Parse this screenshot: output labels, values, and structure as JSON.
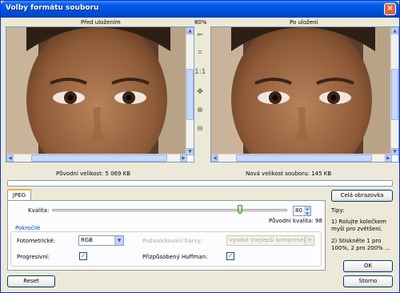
{
  "window": {
    "title": "Volby formátu souboru",
    "close_glyph": "×"
  },
  "zoom": "80%",
  "before": {
    "label": "Před uložením",
    "size_text": "Původní velikost:  5 069 KB"
  },
  "after": {
    "label": "Po uložení",
    "size_text": "Nová velikost souboru:  145 KB"
  },
  "toolbar": [
    {
      "icon": "arrow-left-icon",
      "glyph": "⇐"
    },
    {
      "icon": "fit-to-window-icon",
      "glyph": "⌗"
    },
    {
      "icon": "actual-size-icon",
      "glyph": "1:1"
    },
    {
      "icon": "pan-icon",
      "glyph": "✥"
    },
    {
      "icon": "zoom-in-icon",
      "glyph": "⊕"
    },
    {
      "icon": "zoom-out-icon",
      "glyph": "⊖"
    }
  ],
  "tabs": {
    "jpeg": "JPEG"
  },
  "quality": {
    "label": "Kvalita:",
    "value": "80",
    "fraction": 0.8,
    "original_text": "Původní kvalita: 98"
  },
  "advanced": {
    "title": "Pokročilé",
    "photometric_label": "Fotometrické:",
    "photometric_value": "RGB",
    "subsampling_label": "Podvzorkování barvy:",
    "subsampling_value": "Vysoké (nejlepší komprese)",
    "progressive_label": "Progresivní:",
    "progressive_checked": true,
    "huffman_label": "Přizpůsobený Huffman:",
    "huffman_checked": true
  },
  "buttons": {
    "fullscreen": "Celá obrazovka",
    "ok": "OK",
    "cancel": "Storno",
    "reset": "Reset"
  },
  "tips": {
    "title": "Tipy:",
    "tip1": "1) Rolujte kolečkem myši pro zvětšení.",
    "tip2": "2) Stiskněte 1 pro 100%, 2 pro 200% ..."
  },
  "colors": {
    "title_blue": "#0054e3",
    "group_title": "#0046d5",
    "check_green": "#21a121"
  }
}
